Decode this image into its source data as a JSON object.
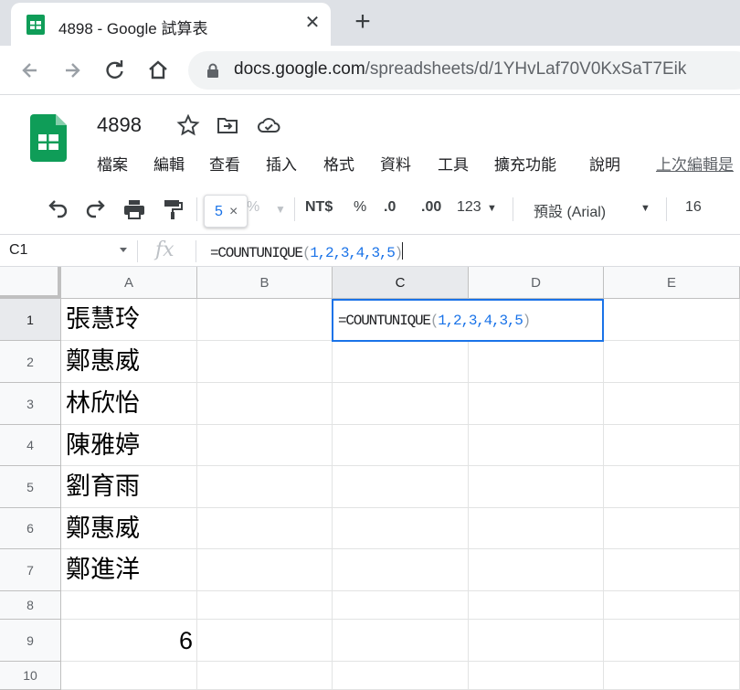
{
  "browser": {
    "tab_title": "4898 - Google 試算表",
    "url_host": "docs.google.com",
    "url_path": "/spreadsheets/d/1YHvLaf70V0KxSaT7Eik"
  },
  "doc": {
    "title": "4898",
    "menu": [
      "檔案",
      "編輯",
      "查看",
      "插入",
      "格式",
      "資料",
      "工具",
      "擴充功能",
      "說明"
    ],
    "last_edit": "上次編輯是"
  },
  "toolbar": {
    "percent_partial": "%",
    "currency": "NT$",
    "percent": "%",
    "decrease_decimal": ".0",
    "increase_decimal": ".00",
    "more_formats": "123",
    "font": "預設 (Arial)",
    "font_size": "16"
  },
  "tooltip": {
    "value": "5",
    "close": "×"
  },
  "formula_bar": {
    "cell_ref": "C1",
    "fx": "fx",
    "prefix": "=COUNTUNIQUE",
    "open": "(",
    "args": "1,2,3,4,3,5",
    "close": ")"
  },
  "grid": {
    "columns": [
      "A",
      "B",
      "C",
      "D",
      "E"
    ],
    "rows": [
      "1",
      "2",
      "3",
      "4",
      "5",
      "6",
      "7",
      "8",
      "9",
      "10"
    ],
    "names": [
      "張慧玲",
      "鄭惠威",
      "林欣怡",
      "陳雅婷",
      "劉育雨",
      "鄭惠威",
      "鄭進洋"
    ],
    "a9": "6",
    "active_cell": "C1"
  },
  "colors": {
    "accent": "#1a73e8",
    "sheets_green": "#0f9d58"
  },
  "icons": [
    "sheets-favicon",
    "close-icon",
    "plus-icon",
    "back-icon",
    "forward-icon",
    "reload-icon",
    "home-icon",
    "lock-icon",
    "star-icon",
    "move-to-folder-icon",
    "cloud-saved-icon",
    "undo-icon",
    "redo-icon",
    "print-icon",
    "paint-format-icon",
    "fx-icon"
  ]
}
